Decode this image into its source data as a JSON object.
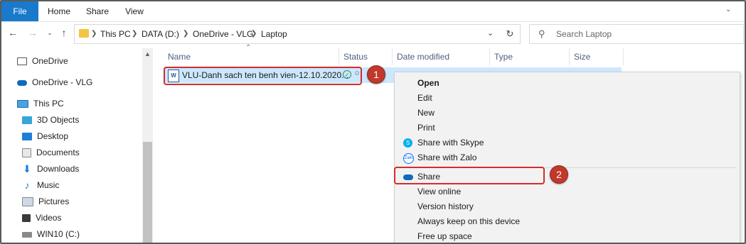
{
  "ribbon": {
    "tabs": [
      "File",
      "Home",
      "Share",
      "View"
    ]
  },
  "address": {
    "segments": [
      "This PC",
      "DATA (D:)",
      "OneDrive - VLG",
      "Laptop"
    ],
    "search_placeholder": "Search Laptop"
  },
  "nav": {
    "items": [
      "OneDrive",
      "OneDrive - VLG",
      "This PC",
      "3D Objects",
      "Desktop",
      "Documents",
      "Downloads",
      "Music",
      "Pictures",
      "Videos",
      "WIN10 (C:)"
    ]
  },
  "columns": [
    "Name",
    "Status",
    "Date modified",
    "Type",
    "Size"
  ],
  "file": {
    "name": "VLU-Danh sach ten benh vien-12.10.2020...",
    "type_icon": "W"
  },
  "context_menu": {
    "items": [
      "Open",
      "Edit",
      "New",
      "Print",
      "Share with Skype",
      "Share with Zalo",
      "Share",
      "View online",
      "Version history",
      "Always keep on this device",
      "Free up space"
    ]
  },
  "callouts": {
    "first": "1",
    "second": "2"
  },
  "colors": {
    "accent": "#1979ca",
    "selection": "#cce8ff",
    "highlight": "#d62b2b",
    "badge": "#c0392b"
  }
}
